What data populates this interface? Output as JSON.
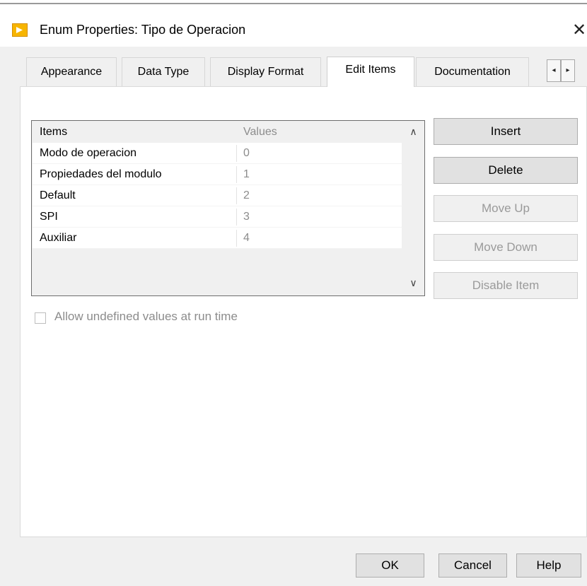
{
  "window": {
    "title": "Enum Properties: Tipo de Operacion",
    "close_glyph": "✕",
    "icon": "labview-app-icon"
  },
  "tabs": [
    {
      "label": "Appearance",
      "active": false
    },
    {
      "label": "Data Type",
      "active": false
    },
    {
      "label": "Display Format",
      "active": false
    },
    {
      "label": "Edit Items",
      "active": true
    },
    {
      "label": "Documentation",
      "active": false
    }
  ],
  "tab_scroll": {
    "left": "◂",
    "right": "▸"
  },
  "table": {
    "headers": {
      "items": "Items",
      "values": "Values"
    },
    "rows": [
      {
        "item": "Modo de operacion",
        "value": "0"
      },
      {
        "item": "Propiedades del modulo",
        "value": "1"
      },
      {
        "item": "Default",
        "value": "2"
      },
      {
        "item": "SPI",
        "value": "3"
      },
      {
        "item": "Auxiliar",
        "value": "4"
      }
    ],
    "scroll_up": "∧",
    "scroll_down": "∨"
  },
  "actions": {
    "insert": "Insert",
    "delete": "Delete",
    "move_up": "Move Up",
    "move_down": "Move Down",
    "disable_item": "Disable Item"
  },
  "allow_undefined": {
    "label": "Allow undefined values at run time",
    "checked": false
  },
  "footer": {
    "ok": "OK",
    "cancel": "Cancel",
    "help": "Help"
  },
  "colors": {
    "accent_icon": "#f7b500",
    "disabled_text": "#9a9a9a"
  }
}
